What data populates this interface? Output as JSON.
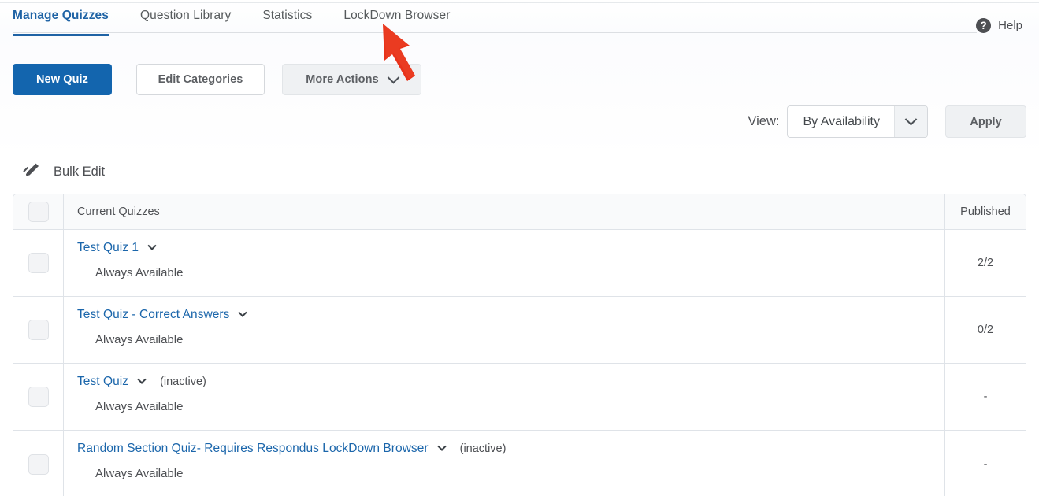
{
  "nav": {
    "tabs": [
      {
        "label": "Manage Quizzes",
        "active": true
      },
      {
        "label": "Question Library",
        "active": false
      },
      {
        "label": "Statistics",
        "active": false
      },
      {
        "label": "LockDown Browser",
        "active": false
      }
    ],
    "help": {
      "label": "Help",
      "icon": "help-circle-icon"
    }
  },
  "toolbar": {
    "new_quiz_label": "New Quiz",
    "edit_categories_label": "Edit Categories",
    "more_actions_label": "More Actions",
    "more_actions_icon": "chevron-down-icon"
  },
  "view": {
    "label": "View:",
    "selected": "By Availability",
    "dropdown_icon": "chevron-down-icon",
    "apply_label": "Apply"
  },
  "bulk_edit": {
    "label": "Bulk Edit",
    "icon": "pencil-edit-icon"
  },
  "table": {
    "headers": {
      "select_all": "",
      "main": "Current Quizzes",
      "published": "Published"
    },
    "rows": [
      {
        "title": "Test Quiz 1",
        "status": "",
        "availability": "Always Available",
        "published": "2/2"
      },
      {
        "title": "Test Quiz - Correct Answers",
        "status": "",
        "availability": "Always Available",
        "published": "0/2"
      },
      {
        "title": "Test Quiz",
        "status": "(inactive)",
        "availability": "Always Available",
        "published": "-"
      },
      {
        "title": "Random Section Quiz- Requires Respondus LockDown Browser",
        "status": "(inactive)",
        "availability": "Always Available",
        "published": "-"
      }
    ]
  },
  "annotation": {
    "type": "red-arrow",
    "color": "#E8321A",
    "points_to": "LockDown Browser"
  },
  "colors": {
    "accent_blue": "#1365ae",
    "link_blue": "#1b66ab",
    "tab_active": "#1f63a5",
    "text_gray": "#4d4f53",
    "border": "#dfe3e8",
    "annotation_red": "#E8321A"
  }
}
